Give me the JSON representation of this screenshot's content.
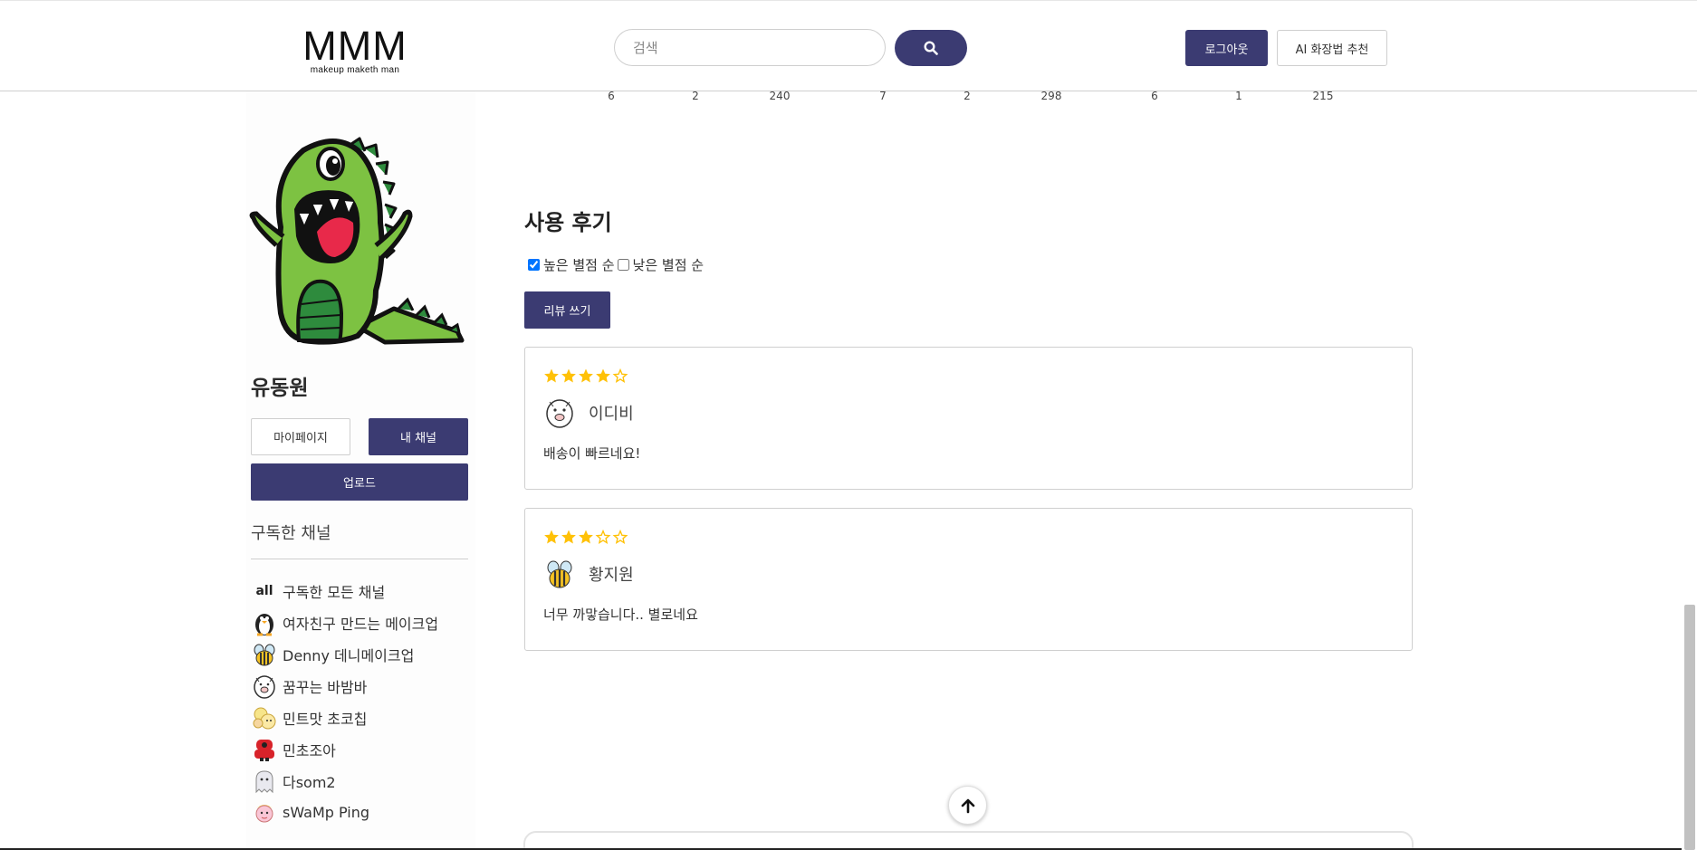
{
  "header": {
    "logo_main": "MMM",
    "logo_sub": "makeup maketh man",
    "search_placeholder": "검색",
    "logout_label": "로그아웃",
    "ai_label": "AI 화장법 추천"
  },
  "stats_row": [
    "6",
    "2",
    "240",
    "7",
    "2",
    "298",
    "6",
    "1",
    "215"
  ],
  "sidebar": {
    "user_name": "유동원",
    "mypage_label": "마이페이지",
    "mychannel_label": "내 채널",
    "upload_label": "업로드",
    "subscribed_title": "구독한 채널",
    "channels": [
      {
        "icon": "all",
        "label": "구독한 모든 채널"
      },
      {
        "icon": "penguin-avatar-icon",
        "label": "여자친구 만드는 메이크업"
      },
      {
        "icon": "bee-avatar-icon",
        "label": "Denny 데니메이크업"
      },
      {
        "icon": "pig-avatar-icon",
        "label": "꿈꾸는 바밤바"
      },
      {
        "icon": "characters-avatar-icon",
        "label": "민트맛 초코칩"
      },
      {
        "icon": "red-robot-avatar-icon",
        "label": "민초조아"
      },
      {
        "icon": "ghost-avatar-icon",
        "label": "다som2"
      },
      {
        "icon": "pink-character-avatar-icon",
        "label": "sWaMp Ping"
      }
    ]
  },
  "reviews": {
    "title": "사용 후기",
    "sort_high_label": "높은 별점 순",
    "sort_low_label": "낮은 별점 순",
    "sort_high_checked": true,
    "sort_low_checked": false,
    "write_label": "리뷰 쓰기",
    "star_color": "#FFC107",
    "items": [
      {
        "rating": 4,
        "max": 5,
        "avatar": "pig-avatar-icon",
        "name": "이디비",
        "text": "배송이 빠르네요!"
      },
      {
        "rating": 3,
        "max": 5,
        "avatar": "bee-avatar-icon",
        "name": "황지원",
        "text": "너무 까맣습니다.. 별로네요"
      }
    ]
  },
  "colors": {
    "primary": "#3b3b72",
    "border": "#cfcfcf"
  }
}
